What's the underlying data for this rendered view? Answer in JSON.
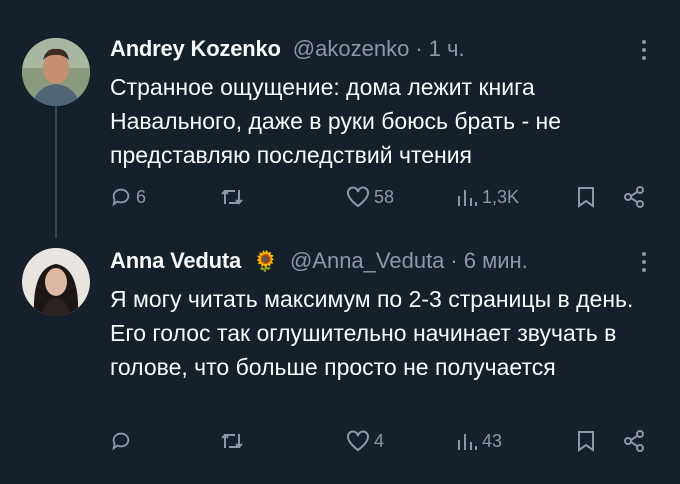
{
  "tweets": [
    {
      "name": "Andrey Kozenko",
      "badge": "",
      "handle": "@akozenko",
      "dot": "·",
      "time": "1 ч.",
      "text": "Странное ощущение: дома лежит книга Навального, даже в руки боюсь брать - не представляю последствий чтения",
      "replies": "6",
      "retweets": "",
      "likes": "58",
      "views": "1,3K"
    },
    {
      "name": "Anna Veduta",
      "badge": "🌻",
      "handle": "@Anna_Veduta",
      "dot": "·",
      "time": "6 мин.",
      "text": "Я могу читать максимум по 2-3 страницы в день. Его голос так оглушительно начинает звучать в голове, что больше просто не получается",
      "replies": "",
      "retweets": "",
      "likes": "4",
      "views": "43"
    }
  ],
  "icons": {
    "reply": "reply-icon",
    "retweet": "retweet-icon",
    "like": "heart-icon",
    "views": "views-icon",
    "bookmark": "bookmark-icon",
    "share": "share-icon",
    "more": "more-icon"
  },
  "colors": {
    "background": "#15202b",
    "text": "#f7f9f9",
    "secondary": "#8b98a5",
    "thread_line": "#38444d"
  }
}
